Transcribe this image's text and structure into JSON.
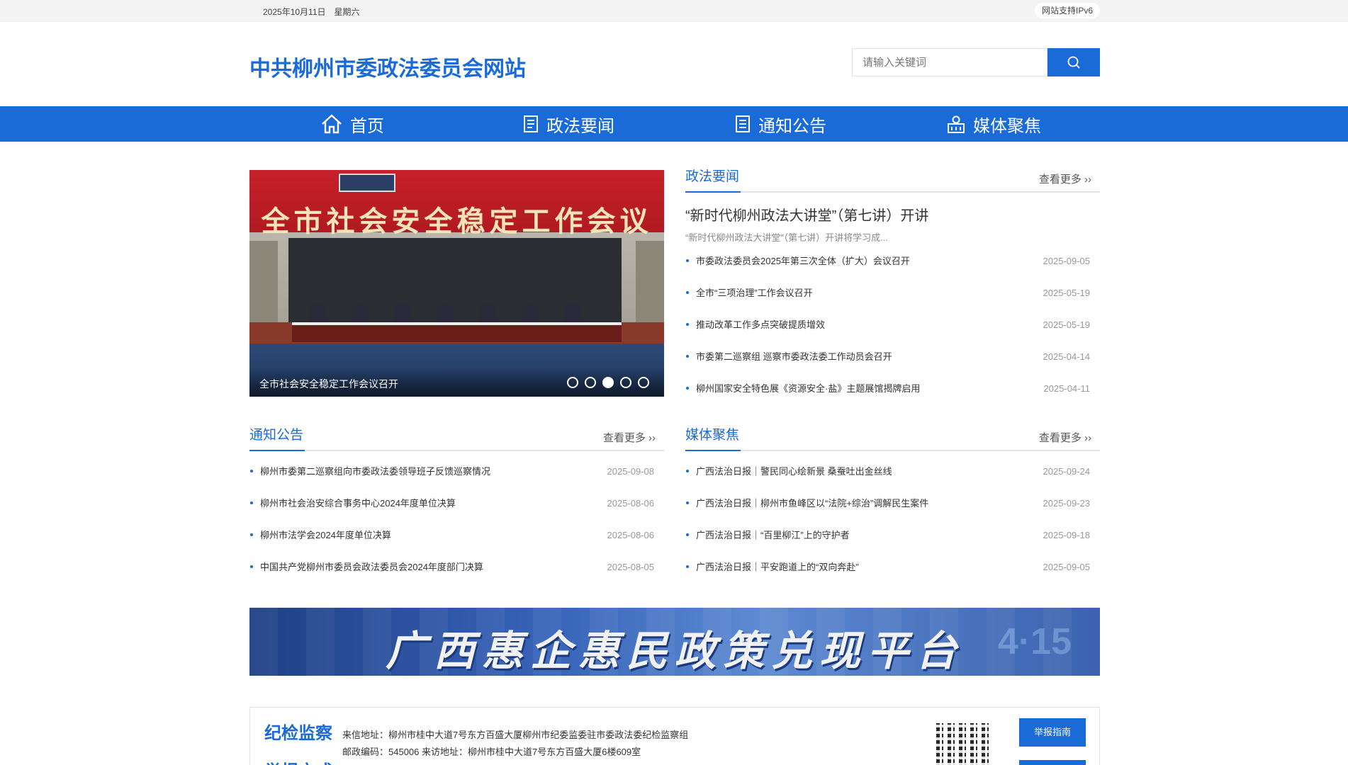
{
  "topbar": {
    "date": "2025年10月11日",
    "weekday": "星期六",
    "ipv6": "网站支持IPv6"
  },
  "header": {
    "site_title": "中共柳州市委政法委员会网站",
    "search_placeholder": "请输入关键词"
  },
  "nav": {
    "items": [
      {
        "label": "首页",
        "icon": "home-icon"
      },
      {
        "label": "政法要闻",
        "icon": "document-icon"
      },
      {
        "label": "通知公告",
        "icon": "notice-icon"
      },
      {
        "label": "媒体聚焦",
        "icon": "media-icon"
      }
    ]
  },
  "carousel": {
    "banner_text": "全市社会安全稳定工作会议",
    "caption": "全市社会安全稳定工作会议召开",
    "slide_count": 5,
    "active_index": 2
  },
  "news": {
    "heading": "政法要闻",
    "more": "查看更多 ››",
    "featured_title": "“新时代柳州政法大讲堂”（第七讲）开讲",
    "featured_desc": "“新时代柳州政法大讲堂”（第七讲）开讲将学习成...",
    "items": [
      {
        "title": "市委政法委员会2025年第三次全体（扩大）会议召开",
        "date": "2025-09-05"
      },
      {
        "title": "全市“三项治理”工作会议召开",
        "date": "2025-05-19"
      },
      {
        "title": "推动改革工作多点突破提质增效",
        "date": "2025-05-19"
      },
      {
        "title": "市委第二巡察组 巡察市委政法委工作动员会召开",
        "date": "2025-04-14"
      },
      {
        "title": "柳州国家安全特色展《资源安全·盐》主题展馆揭牌启用",
        "date": "2025-04-11"
      }
    ]
  },
  "notices": {
    "heading": "通知公告",
    "more": "查看更多 ››",
    "items": [
      {
        "title": "柳州市委第二巡察组向市委政法委领导班子反馈巡察情况",
        "date": "2025-09-08"
      },
      {
        "title": "柳州市社会治安综合事务中心2024年度单位决算",
        "date": "2025-08-06"
      },
      {
        "title": "柳州市法学会2024年度单位决算",
        "date": "2025-08-06"
      },
      {
        "title": "中国共产党柳州市委员会政法委员会2024年度部门决算",
        "date": "2025-08-05"
      }
    ]
  },
  "media": {
    "heading": "媒体聚焦",
    "more": "查看更多 ››",
    "items": [
      {
        "title": "广西法治日报｜警民同心绘新景 桑蚕吐出金丝线",
        "date": "2025-09-24"
      },
      {
        "title": "广西法治日报｜柳州市鱼峰区以“法院+综治”调解民生案件",
        "date": "2025-09-23"
      },
      {
        "title": "广西法治日报｜“百里柳江”上的守护者",
        "date": "2025-09-18"
      },
      {
        "title": "广西法治日报｜平安跑道上的“双向奔赴”",
        "date": "2025-09-05"
      }
    ]
  },
  "policy_banner": {
    "text": "广西惠企惠民政策兑现平台",
    "num": "4·15"
  },
  "discipline": {
    "title": "纪检监察",
    "line1": "来信地址：柳州市桂中大道7号东方百盛大厦柳州市纪委监委驻市委政法委纪检监察组",
    "line2": "邮政编码：545006 来访地址：柳州市桂中大道7号东方百盛大厦6楼609室",
    "report_button": "举报指南",
    "title2": "举报方式"
  },
  "colors": {
    "brand": "#1a6ad8"
  }
}
